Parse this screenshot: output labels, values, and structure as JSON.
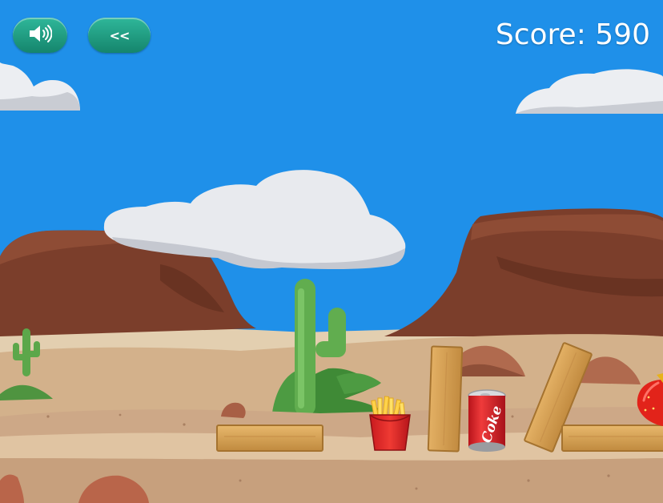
{
  "hud": {
    "score_label": "Score: 590",
    "sound_icon": "speaker-icon",
    "back_icon": "double-chevron-left-icon",
    "back_label": "<<"
  },
  "items": {
    "can_text": "Coke"
  },
  "colors": {
    "sky": "#1e8fe8",
    "button": "#1a9d80",
    "mesa": "#7b3f2c",
    "sand": "#ceaa86",
    "plank": "#d9a45a"
  }
}
